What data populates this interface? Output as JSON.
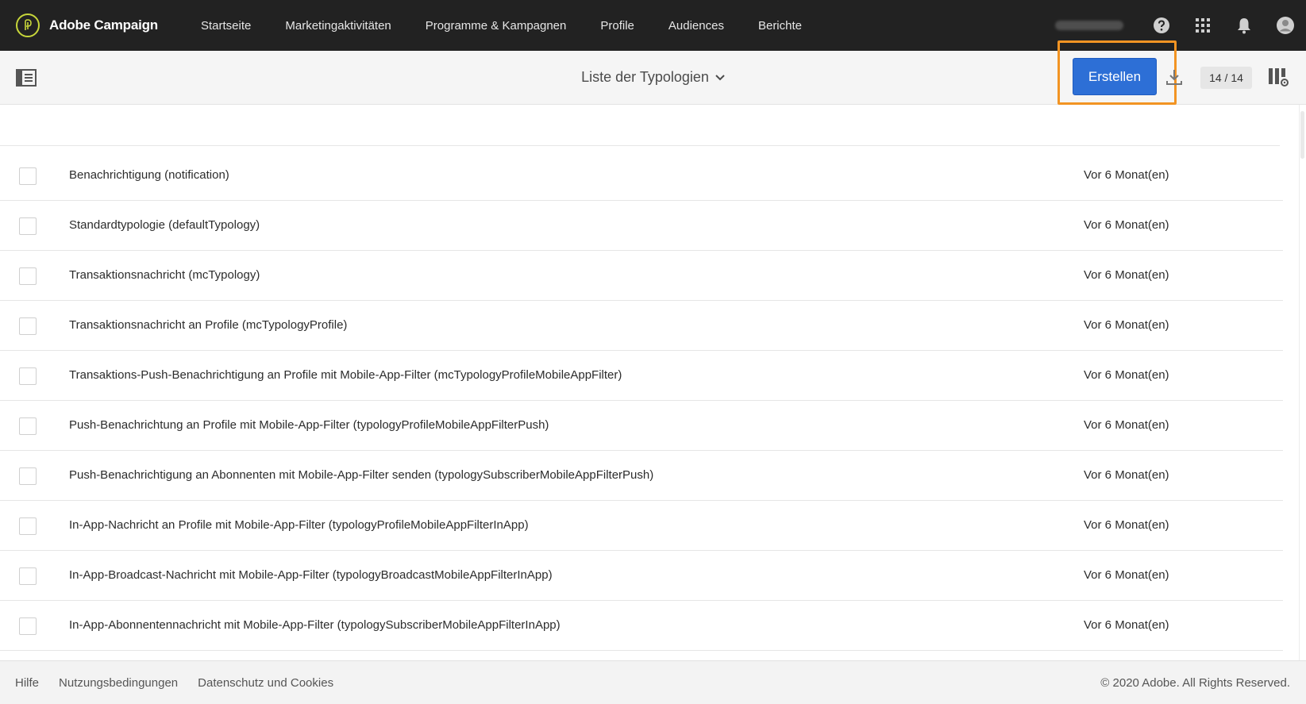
{
  "app": {
    "brand_name": "Adobe Campaign",
    "logo_icon": "adobe-campaign-logo",
    "accent_color": "#c7d63a"
  },
  "nav": {
    "items": [
      {
        "label": "Startseite"
      },
      {
        "label": "Marketingaktivitäten"
      },
      {
        "label": "Programme & Kampagnen"
      },
      {
        "label": "Profile"
      },
      {
        "label": "Audiences"
      },
      {
        "label": "Berichte"
      }
    ],
    "icons": [
      "help-icon",
      "apps-grid-icon",
      "notification-bell-icon",
      "user-avatar-icon"
    ]
  },
  "toolbar": {
    "view_title": "Liste der Typologien",
    "create_label": "Erstellen",
    "create_color": "#2d6fd6",
    "highlight_color": "#f29423",
    "count": "14 / 14"
  },
  "list": {
    "rows": [
      {
        "label": "Benachrichtigung (notification)",
        "date": "Vor 6 Monat(en)"
      },
      {
        "label": "Standardtypologie (defaultTypology)",
        "date": "Vor 6 Monat(en)"
      },
      {
        "label": "Transaktionsnachricht (mcTypology)",
        "date": "Vor 6 Monat(en)"
      },
      {
        "label": "Transaktionsnachricht an Profile (mcTypologyProfile)",
        "date": "Vor 6 Monat(en)"
      },
      {
        "label": "Transaktions-Push-Benachrichtigung an Profile mit Mobile-App-Filter (mcTypologyProfileMobileAppFilter)",
        "date": "Vor 6 Monat(en)"
      },
      {
        "label": "Push-Benachrichtung an Profile mit Mobile-App-Filter (typologyProfileMobileAppFilterPush)",
        "date": "Vor 6 Monat(en)"
      },
      {
        "label": "Push-Benachrichtigung an Abonnenten mit Mobile-App-Filter senden (typologySubscriberMobileAppFilterPush)",
        "date": "Vor 6 Monat(en)"
      },
      {
        "label": "In-App-Nachricht an Profile mit Mobile-App-Filter (typologyProfileMobileAppFilterInApp)",
        "date": "Vor 6 Monat(en)"
      },
      {
        "label": "In-App-Broadcast-Nachricht mit Mobile-App-Filter (typologyBroadcastMobileAppFilterInApp)",
        "date": "Vor 6 Monat(en)"
      },
      {
        "label": "In-App-Abonnentennachricht mit Mobile-App-Filter (typologySubscriberMobileAppFilterInApp)",
        "date": "Vor 6 Monat(en)"
      }
    ]
  },
  "footer": {
    "links": [
      {
        "label": "Hilfe"
      },
      {
        "label": "Nutzungsbedingungen"
      },
      {
        "label": "Datenschutz und Cookies"
      }
    ],
    "copyright": "© 2020 Adobe. All Rights Reserved."
  }
}
